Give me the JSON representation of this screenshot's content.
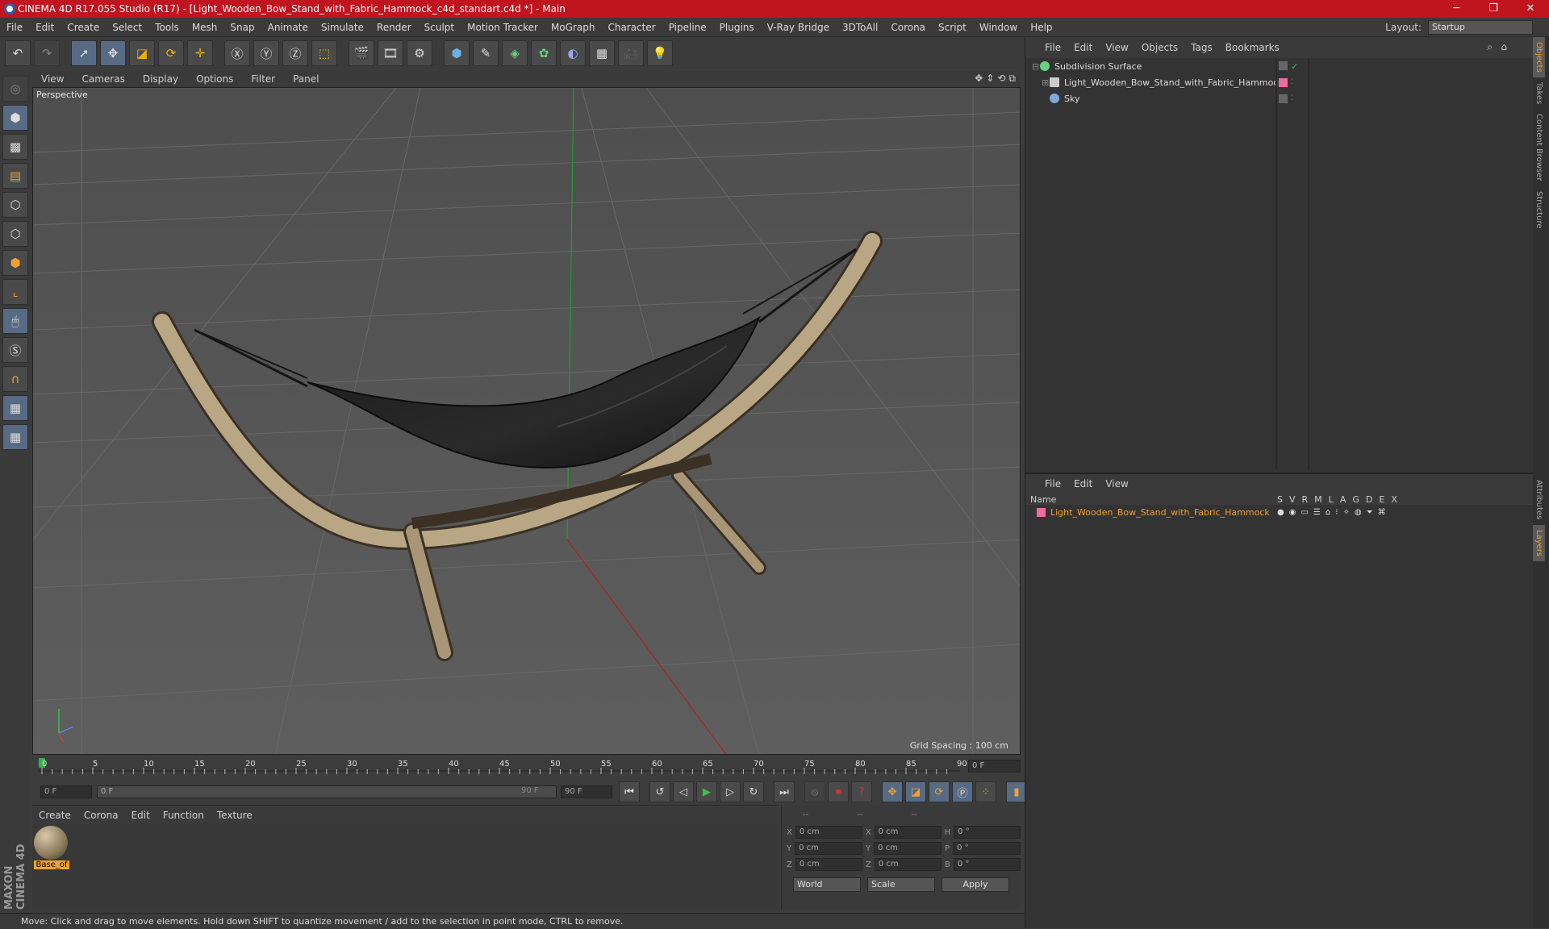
{
  "titlebar": {
    "title": "CINEMA 4D R17.055 Studio (R17) - [Light_Wooden_Bow_Stand_with_Fabric_Hammock_c4d_standart.c4d *] - Main",
    "min": "─",
    "max": "❐",
    "close": "✕"
  },
  "menubar": {
    "items": [
      "File",
      "Edit",
      "Create",
      "Select",
      "Tools",
      "Mesh",
      "Snap",
      "Animate",
      "Simulate",
      "Render",
      "Sculpt",
      "Motion Tracker",
      "MoGraph",
      "Character",
      "Pipeline",
      "Plugins",
      "V-Ray Bridge",
      "3DToAll",
      "Corona",
      "Script",
      "Window",
      "Help"
    ],
    "layout_label": "Layout:",
    "layout_value": "Startup"
  },
  "viewport": {
    "menu": [
      "View",
      "Cameras",
      "Display",
      "Options",
      "Filter",
      "Panel"
    ],
    "label": "Perspective",
    "grid_spacing": "Grid Spacing : 100 cm"
  },
  "timeline": {
    "ticks": [
      "0",
      "5",
      "10",
      "15",
      "20",
      "25",
      "30",
      "35",
      "40",
      "45",
      "50",
      "55",
      "60",
      "65",
      "70",
      "75",
      "80",
      "85",
      "90"
    ],
    "frame_end": "0 F"
  },
  "transport": {
    "start": "0 F",
    "range_start": "0 F",
    "range_end": "90 F",
    "end": "90 F"
  },
  "materials": {
    "menu": [
      "Create",
      "Corona",
      "Edit",
      "Function",
      "Texture"
    ],
    "items": [
      {
        "name": "Base_of"
      }
    ]
  },
  "coords": {
    "headers": [
      "--",
      "--",
      "--"
    ],
    "rows": [
      {
        "a": "X",
        "av": "0 cm",
        "b": "X",
        "bv": "0 cm",
        "c": "H",
        "cv": "0 °"
      },
      {
        "a": "Y",
        "av": "0 cm",
        "b": "Y",
        "bv": "0 cm",
        "c": "P",
        "cv": "0 °"
      },
      {
        "a": "Z",
        "av": "0 cm",
        "b": "Z",
        "bv": "0 cm",
        "c": "B",
        "cv": "0 °"
      }
    ],
    "mode": "World",
    "scale": "Scale",
    "apply": "Apply"
  },
  "objects": {
    "menu": [
      "File",
      "Edit",
      "View",
      "Objects",
      "Tags",
      "Bookmarks"
    ],
    "items": [
      {
        "name": "Subdivision Surface"
      },
      {
        "name": "Light_Wooden_Bow_Stand_with_Fabric_Hammock"
      },
      {
        "name": "Sky"
      }
    ]
  },
  "layers": {
    "menu": [
      "File",
      "Edit",
      "View"
    ],
    "header_name": "Name",
    "cols": [
      "S",
      "V",
      "R",
      "M",
      "L",
      "A",
      "G",
      "D",
      "E",
      "X"
    ],
    "items": [
      {
        "name": "Light_Wooden_Bow_Stand_with_Fabric_Hammock"
      }
    ]
  },
  "right_tabs": [
    "Objects",
    "Takes",
    "Content Browser",
    "Structure",
    "Attributes",
    "Layers"
  ],
  "status": "Move: Click and drag to move elements. Hold down SHIFT to quantize movement / add to the selection in point mode, CTRL to remove.",
  "colors": {
    "title": "#c0141e",
    "accent": "#f0a030",
    "layer": "#f06aa0"
  }
}
